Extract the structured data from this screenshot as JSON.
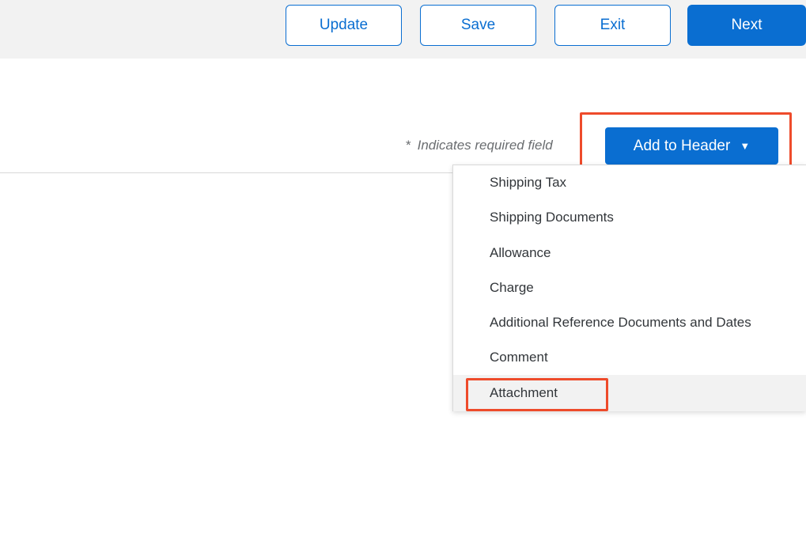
{
  "toolbar": {
    "update_label": "Update",
    "save_label": "Save",
    "exit_label": "Exit",
    "next_label": "Next"
  },
  "form": {
    "required_asterisk": "*",
    "required_note": "Indicates required field",
    "add_to_header_label": "Add to Header",
    "add_to_header_caret": "▼"
  },
  "dropdown": {
    "items": [
      {
        "label": "Shipping Tax"
      },
      {
        "label": "Shipping Documents"
      },
      {
        "label": "Allowance"
      },
      {
        "label": "Charge"
      },
      {
        "label": "Additional Reference Documents and Dates"
      },
      {
        "label": "Comment"
      },
      {
        "label": "Attachment",
        "selected": true
      }
    ]
  },
  "colors": {
    "primary": "#0a6ed1",
    "highlight": "#ee4b2b",
    "toolbar_bg": "#f2f2f2"
  }
}
